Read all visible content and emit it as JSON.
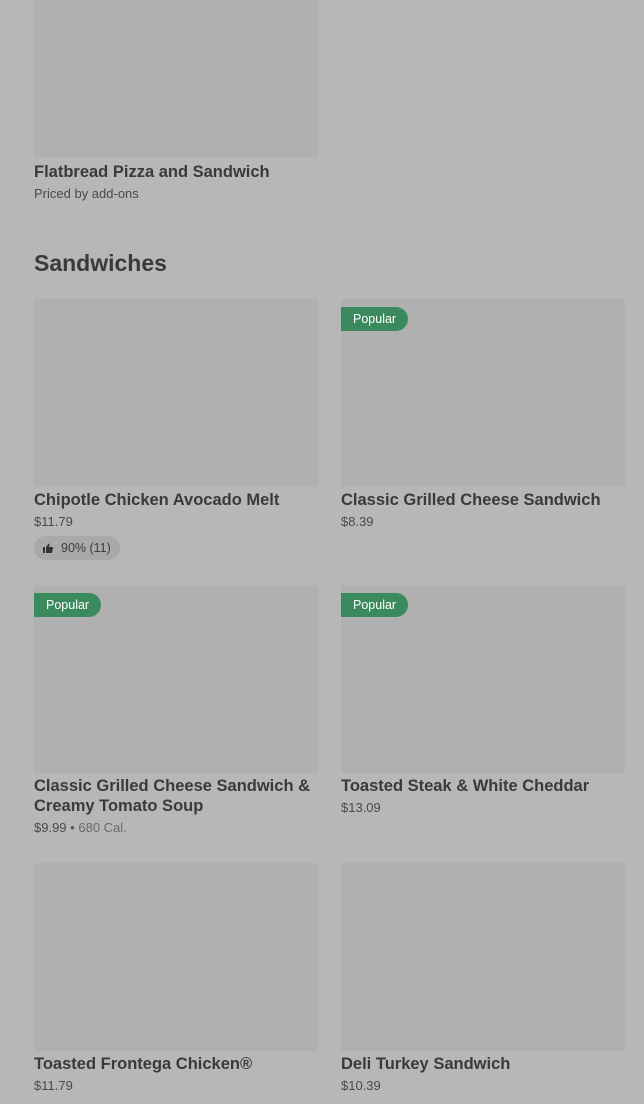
{
  "top_item": {
    "name": "Flatbread Pizza and Sandwich",
    "price_note": "Priced by add-ons"
  },
  "section": {
    "title": "Sandwiches"
  },
  "items": [
    {
      "name": "Chipotle Chicken Avocado Melt",
      "price": "$11.79",
      "rating": "90% (11)"
    },
    {
      "name": "Classic Grilled Cheese Sandwich",
      "price": "$8.39",
      "badge": "Popular"
    },
    {
      "name": "Classic Grilled Cheese Sandwich & Creamy Tomato Soup",
      "price": "$9.99",
      "separator": "•",
      "calories": "680 Cal.",
      "badge": "Popular"
    },
    {
      "name": "Toasted Steak & White Cheddar",
      "price": "$13.09",
      "badge": "Popular"
    },
    {
      "name": "Toasted Frontega Chicken®",
      "price": "$11.79"
    },
    {
      "name": "Deli Turkey Sandwich",
      "price": "$10.39"
    }
  ],
  "colors": {
    "badge": "#3b8a5e",
    "background": "#b7b7b7"
  }
}
